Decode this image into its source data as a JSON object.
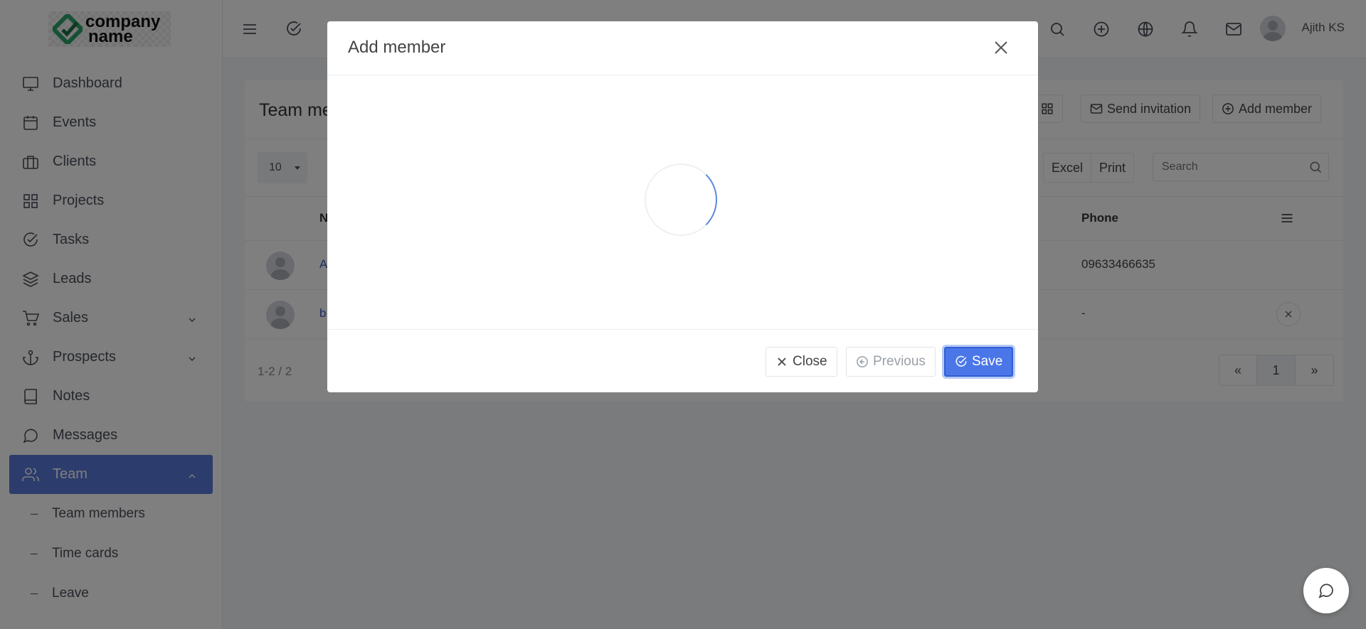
{
  "brand": {
    "line1": "company",
    "line2": "name"
  },
  "sidebar": {
    "items": [
      {
        "label": "Dashboard",
        "icon": "monitor-icon"
      },
      {
        "label": "Events",
        "icon": "calendar-icon"
      },
      {
        "label": "Clients",
        "icon": "briefcase-icon"
      },
      {
        "label": "Projects",
        "icon": "grid-icon"
      },
      {
        "label": "Tasks",
        "icon": "check-circle-icon"
      },
      {
        "label": "Leads",
        "icon": "layers-icon"
      },
      {
        "label": "Sales",
        "icon": "cart-icon"
      },
      {
        "label": "Prospects",
        "icon": "anchor-icon"
      },
      {
        "label": "Notes",
        "icon": "book-icon"
      },
      {
        "label": "Messages",
        "icon": "message-icon"
      },
      {
        "label": "Team",
        "icon": "users-icon"
      }
    ],
    "submenu": [
      "Team members",
      "Time cards",
      "Leave"
    ]
  },
  "topbar": {
    "user_name": "Ajith KS"
  },
  "card": {
    "title": "Team me",
    "send_invitation": "Send invitation",
    "add_member": "Add member",
    "page_size": "10",
    "excel": "Excel",
    "print": "Print",
    "search_placeholder": "Search",
    "columns": {
      "name": "N",
      "phone": "Phone"
    },
    "rows": [
      {
        "name": "A",
        "phone": "09633466635"
      },
      {
        "name": "b",
        "phone": "-"
      }
    ],
    "pagination_info": "1-2 / 2",
    "pager": {
      "first": "«",
      "current": "1",
      "next": "»"
    }
  },
  "modal": {
    "title": "Add member",
    "close_label": "Close",
    "previous_label": "Previous",
    "save_label": "Save"
  },
  "colors": {
    "accent": "#5979d9",
    "primary_button": "#4a76e8",
    "link": "#3b5bc4"
  }
}
